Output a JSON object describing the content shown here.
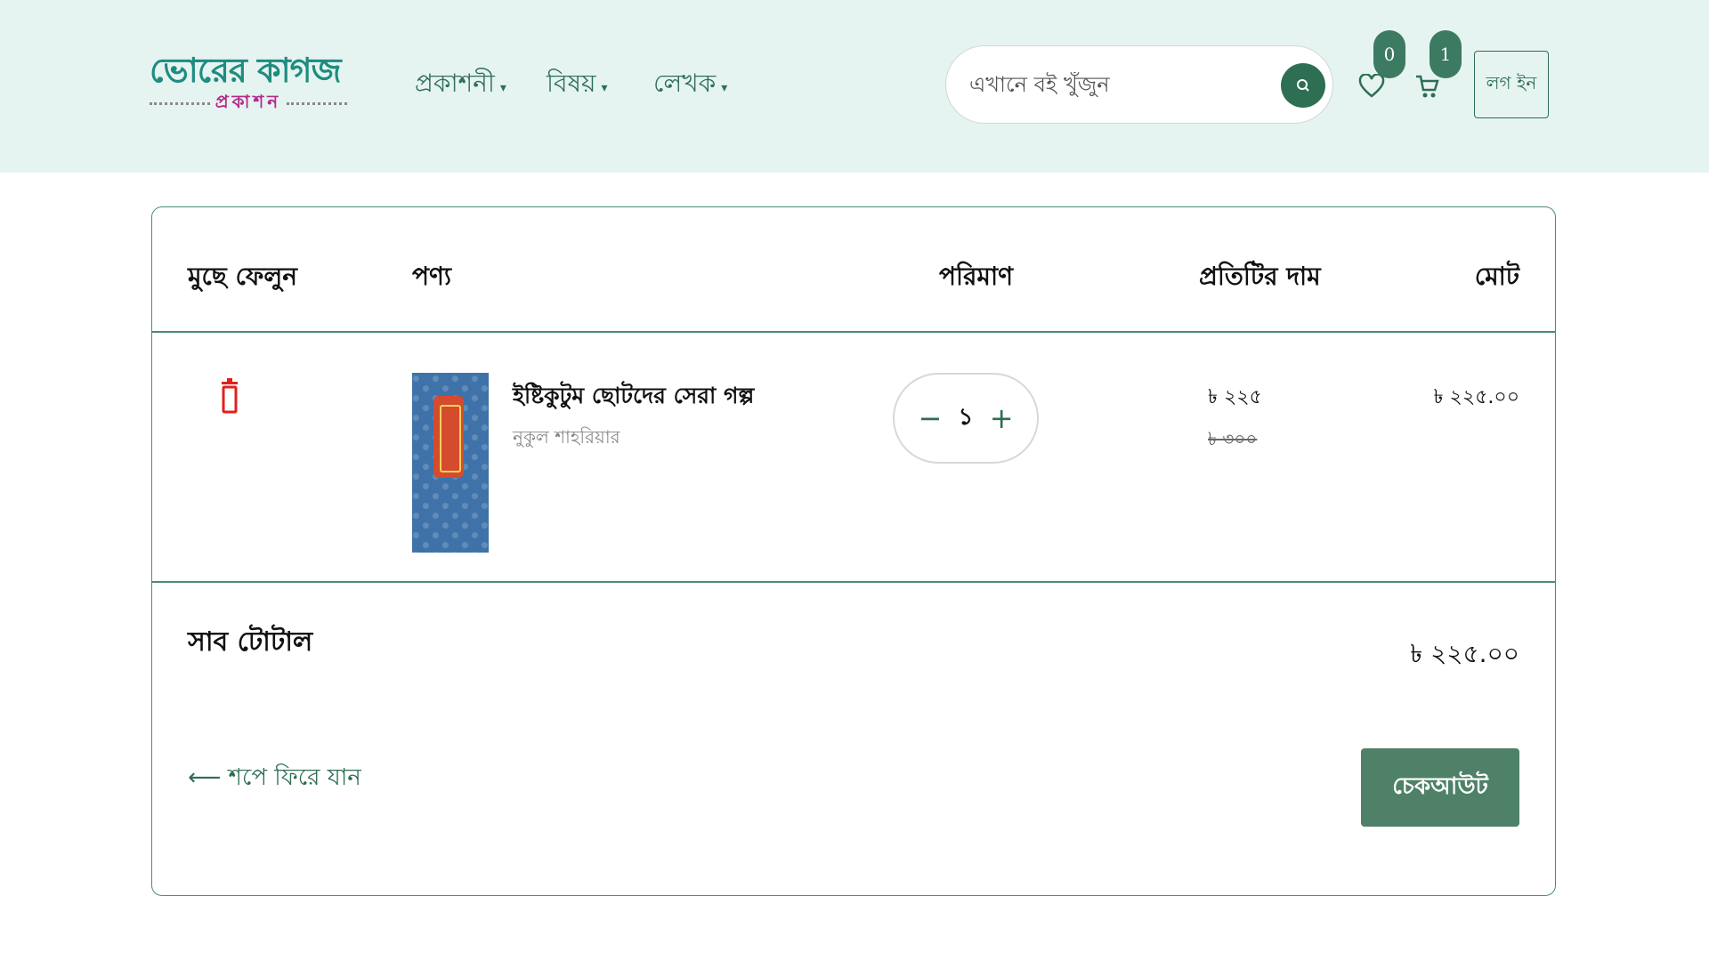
{
  "header": {
    "logo": {
      "top": "ভোরের কাগজ",
      "sub": "প্রকাশন"
    },
    "nav": [
      {
        "label": "প্রকাশনী"
      },
      {
        "label": "বিষয়"
      },
      {
        "label": "লেখক"
      }
    ],
    "search": {
      "placeholder": "এখানে বই খুঁজুন"
    },
    "wishlist_count": "0",
    "cart_count": "1",
    "login_label": "লগ ইন"
  },
  "colors": {
    "brand": "#2e6e53",
    "header_bg": "#e6f4f1",
    "delete": "#e0201e",
    "logo_teal": "#1e8c80",
    "logo_magenta": "#b12d8a"
  },
  "cart": {
    "columns": [
      "মুছে ফেলুন",
      "পণ্য",
      "পরিমাণ",
      "প্রতিটির দাম",
      "মোট"
    ],
    "items": [
      {
        "title": "ইষ্টিকুটুম ছোটদের সেরা গল্প",
        "author": "নুকুল শাহরিয়ার",
        "quantity": "১",
        "price": "৳ ২২৫",
        "original_price": "৳ ৩০০",
        "total": "৳ ২২৫.০০"
      }
    ],
    "subtotal_label": "সাব টোটাল",
    "subtotal_value": "৳ ২২৫.০০",
    "back_link": "⟵ শপে ফিরে যান",
    "checkout_label": "চেকআউট"
  }
}
